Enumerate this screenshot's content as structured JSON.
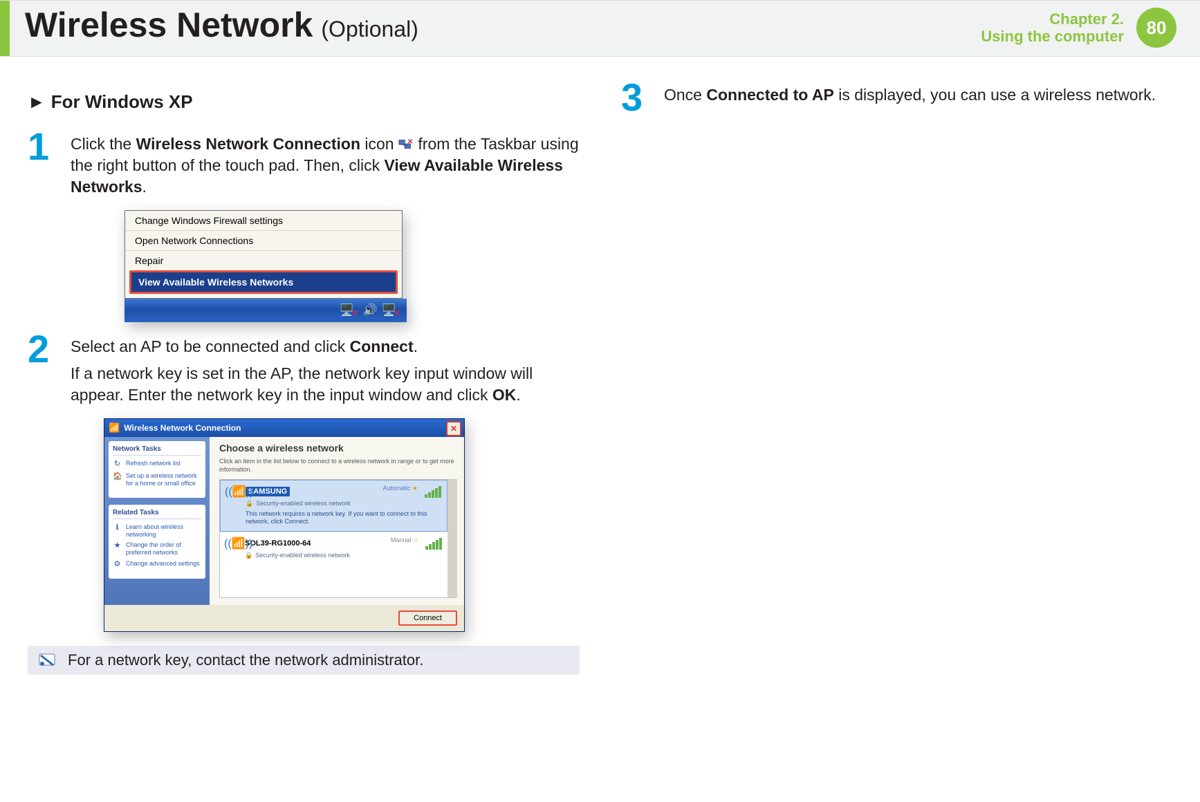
{
  "header": {
    "title": "Wireless Network",
    "subtitle": "(Optional)",
    "chapter_line1": "Chapter 2.",
    "chapter_line2": "Using the computer",
    "page_number": "80"
  },
  "section_heading": {
    "arrow": "►",
    "text": "For Windows XP"
  },
  "steps": {
    "s1": {
      "num": "1",
      "p1_a": "Click the ",
      "p1_b_bold": "Wireless Network Connection",
      "p1_c": " icon ",
      "p1_d": " from the Taskbar using the right button of the touch pad. Then, click ",
      "p1_e_bold": "View Available Wireless Networks",
      "p1_f": "."
    },
    "s2": {
      "num": "2",
      "p1_a": "Select an AP to be connected and click ",
      "p1_b_bold": "Connect",
      "p1_c": ".",
      "p2_a": "If a network key is set in the AP, the network key input window will appear. Enter the network key in the input window and click ",
      "p2_b_bold": "OK",
      "p2_c": "."
    },
    "s3": {
      "num": "3",
      "p1_a": "Once ",
      "p1_b_bold": "Connected to AP",
      "p1_c": " is displayed, you can use a wireless network."
    }
  },
  "fig1": {
    "items": [
      "Change Windows Firewall settings",
      "Open Network Connections",
      "Repair"
    ],
    "active": "View Available Wireless Networks"
  },
  "fig2": {
    "title": "Wireless Network Connection",
    "side": {
      "group1_title": "Network Tasks",
      "g1_link1": "Refresh network list",
      "g1_link2": "Set up a wireless network for a home or small office",
      "group2_title": "Related Tasks",
      "g2_link1": "Learn about wireless networking",
      "g2_link2": "Change the order of preferred networks",
      "g2_link3": "Change advanced settings"
    },
    "main": {
      "heading": "Choose a wireless network",
      "sub": "Click an item in the list below to connect to a wireless network in range or to get more information.",
      "net1": {
        "name": "SAMSUNG",
        "tag": "Automatic",
        "star": "★",
        "sec": "Security-enabled wireless network",
        "desc": "This network requires a network key. If you want to connect to this network, click Connect."
      },
      "net2": {
        "name": "SOL39-RG1000-64",
        "tag": "Manual",
        "star": "☆",
        "sec": "Security-enabled wireless network"
      },
      "connect_label": "Connect"
    }
  },
  "note": "For a network key, contact the network administrator."
}
